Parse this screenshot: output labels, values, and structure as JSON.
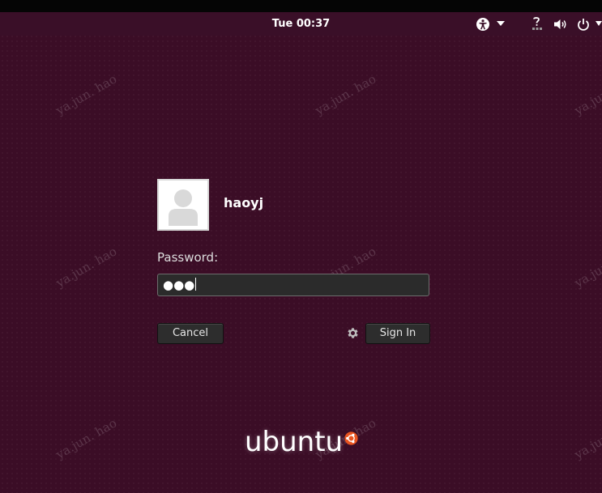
{
  "topbar": {
    "clock": "Tue 00:37",
    "icons": [
      "accessibility-icon",
      "chevron-down-icon",
      "network-unknown-icon",
      "volume-icon",
      "power-icon"
    ]
  },
  "watermark_text": "ya.jun. hao",
  "login": {
    "username": "haoyj",
    "password_label": "Password:",
    "password_value": "●●●",
    "cancel_label": "Cancel",
    "signin_label": "Sign In"
  },
  "branding": {
    "logo_text": "ubuntu"
  },
  "colors": {
    "background": "#3b0d26",
    "topbar": "#050505",
    "field_bg": "#2b2b2b",
    "button_bg": "#2d2d2d",
    "logo_accent": "#e95420"
  }
}
